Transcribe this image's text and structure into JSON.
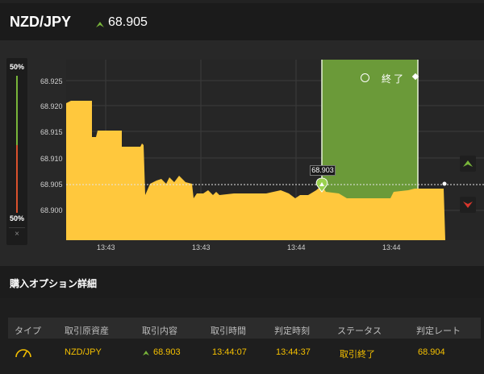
{
  "header": {
    "pair": "NZD/JPY",
    "rate": "68.905",
    "rate_direction": "up",
    "up_color": "#78b53a"
  },
  "meter": {
    "top_pct": "50%",
    "bottom_pct": "50%",
    "close": "×"
  },
  "chart": {
    "y_ticks": [
      "68.925",
      "68.920",
      "68.915",
      "68.910",
      "68.905",
      "68.900"
    ],
    "x_ticks": [
      "13:43",
      "13:43",
      "13:44",
      "13:44"
    ],
    "end_label": "終了",
    "entry_rate": "68.903",
    "colors": {
      "area": "#ffc83d",
      "window": "#6b9a39"
    }
  },
  "section": {
    "title": "購入オプション詳細"
  },
  "table": {
    "headers": [
      "タイプ",
      "取引原資産",
      "取引内容",
      "取引時間",
      "判定時刻",
      "ステータス",
      "判定レート"
    ],
    "row": {
      "asset": "NZD/JPY",
      "content": "68.903",
      "trade_time": "13:44:07",
      "judge_time": "13:44:37",
      "status": "取引終了",
      "judge_rate": "68.904"
    }
  }
}
